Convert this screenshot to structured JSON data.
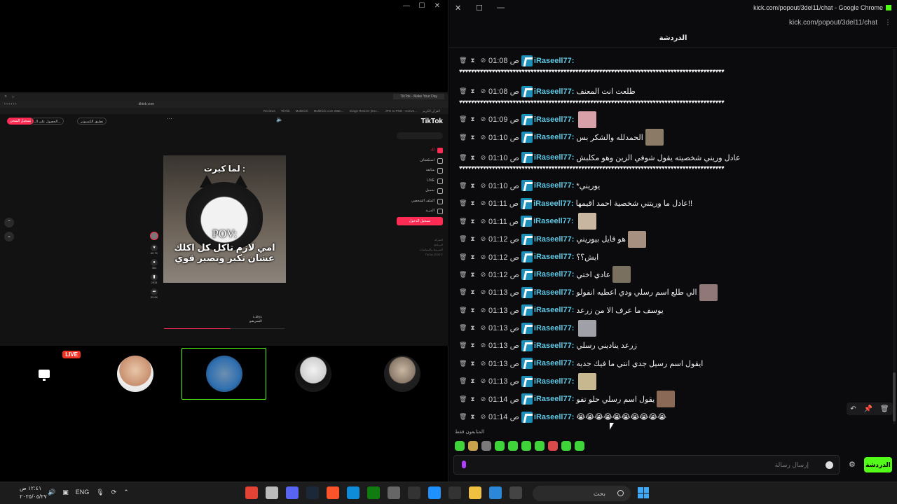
{
  "left_window": {
    "controls": [
      "—",
      "☐",
      "✕"
    ],
    "embedded_browser": {
      "tab_label": "TikTok - Make Your Day",
      "url": "tiktok.com",
      "bookmarks": [
        "Reviews",
        "TikTok",
        "MultiKick",
        "MultiKick.com Watc...",
        "Image Resizer (Exc...",
        "JPG to PNG - Conve...",
        "القرآن الكريم"
      ],
      "tiktok": {
        "logo": "TikTok",
        "live_button": "تسجيل الشحن",
        "get_app": "الحصول على ال...",
        "pc_app": "تطبيق الكمبيوتر",
        "nav": [
          "لك",
          "استكشاف",
          "متابعة",
          "LIVE",
          "تحميل",
          "الملف الشخصي",
          "المزيد"
        ],
        "login": "تسجيل الدخول",
        "footer": [
          "الشركة",
          "البرنامج",
          "الشروط والسياسات",
          "TikTok 2025 ©"
        ],
        "video_caption_top": "لما كبرت :",
        "video_caption_pov": "POV:",
        "video_caption_main": "امي لازم تاكل كل اكلك عشان تكبر وتصير قوي",
        "counts": [
          "60.7K",
          "364",
          "2934",
          "35.6K"
        ],
        "user_handle": "L.dry1",
        "user_sub": "التسريقيو"
      }
    },
    "tiles": {
      "live_badge": "LIVE",
      "colors": [
        "#101010",
        "#c0707a",
        "#2e3a2e",
        "#5a5a5a",
        "#222222"
      ]
    }
  },
  "right_window": {
    "title": "kick.com/popout/3del11/chat - Google Chrome",
    "url": "kick.com/popout/3del11/chat",
    "chat_header": "الدردشة",
    "messages": [
      {
        "time": "01:08",
        "ampm": "ص",
        "user": "iRaseell77:",
        "text": "",
        "line": "♥♥♥♥♥♥♥♥♥♥♥♥♥♥♥♥♥♥♥♥♥♥♥♥♥♥♥♥♥♥♥♥♥♥♥♥♥♥♥♥♥♥♥♥♥♥♥♥♥♥♥♥♥♥♥♥♥♥♥♥♥♥♥♥♥♥♥♥♥♥♥♥♥♥♥♥♥♥♥♥♥♥♥♥♥♥♥♥♥",
        "emotes": []
      },
      {
        "time": "01:08",
        "ampm": "ص",
        "user": "iRaseell77:",
        "text": "طلعت انت المعنف",
        "line": "♥♥♥♥♥♥♥♥♥♥♥♥♥♥♥♥♥♥♥♥♥♥♥♥♥♥♥♥♥♥♥♥♥♥♥♥♥♥♥♥♥♥♥♥♥♥♥♥♥♥♥♥♥♥♥♥♥♥♥♥♥♥♥♥♥♥♥♥♥♥♥♥♥♥♥♥♥♥♥♥♥♥♥♥♥♥♥♥♥",
        "emotes": []
      },
      {
        "time": "01:09",
        "ampm": "ص",
        "user": "iRaseell77:",
        "text": "",
        "line": "",
        "emotes": [
          "#d8a0a8"
        ]
      },
      {
        "time": "01:10",
        "ampm": "ص",
        "user": "iRaseell77:",
        "text": "الحمدلله والشكر بس",
        "line": "",
        "emotes": [
          "#8a7a66"
        ]
      },
      {
        "time": "01:10",
        "ampm": "ص",
        "user": "iRaseell77:",
        "text": "عادل وريني شخصيته يقول شوفي الزين وهو مكلبش",
        "line": "♥♥♥♥♥♥♥♥♥♥♥♥♥♥♥♥♥♥♥♥♥♥♥♥♥♥♥♥♥♥♥♥♥♥♥♥♥♥♥♥♥♥♥♥♥♥♥♥♥♥♥♥♥♥♥♥♥♥♥♥♥♥♥♥♥♥♥♥♥♥♥♥♥♥♥♥♥♥♥♥♥♥♥♥♥♥♥♥♥",
        "emotes": []
      },
      {
        "time": "01:10",
        "ampm": "ص",
        "user": "iRaseell77:",
        "text": "*يوريني",
        "line": "",
        "emotes": []
      },
      {
        "time": "01:11",
        "ampm": "ص",
        "user": "iRaseell77:",
        "text": "عادل ما وريتني شخصية احمد اقيمها!!",
        "line": "",
        "emotes": []
      },
      {
        "time": "01:11",
        "ampm": "ص",
        "user": "iRaseell77:",
        "text": "",
        "line": "",
        "emotes": [
          "#c8b6a0"
        ]
      },
      {
        "time": "01:12",
        "ampm": "ص",
        "user": "iRaseell77:",
        "text": "هو قايل بيوريني",
        "line": "",
        "emotes": [
          "#a89080"
        ]
      },
      {
        "time": "01:12",
        "ampm": "ص",
        "user": "iRaseell77:",
        "text": "ايش؟؟",
        "line": "",
        "emotes": []
      },
      {
        "time": "01:12",
        "ampm": "ص",
        "user": "iRaseell77:",
        "text": "عادي اختي",
        "line": "",
        "emotes": [
          "#7a7060"
        ]
      },
      {
        "time": "01:13",
        "ampm": "ص",
        "user": "iRaseell77:",
        "text": "الي طلع اسم رسلي ودي اعطيه انفولو",
        "line": "",
        "emotes": [
          "#907878"
        ]
      },
      {
        "time": "01:13",
        "ampm": "ص",
        "user": "iRaseell77:",
        "text": "يوسف ما عرف الا من زرعد",
        "line": "",
        "emotes": []
      },
      {
        "time": "01:13",
        "ampm": "ص",
        "user": "iRaseell77:",
        "text": "",
        "line": "",
        "emotes": [
          "#a0a0a8"
        ]
      },
      {
        "time": "01:13",
        "ampm": "ص",
        "user": "iRaseell77:",
        "text": "زرعد يناديني رسلي",
        "line": "",
        "emotes": []
      },
      {
        "time": "01:13",
        "ampm": "ص",
        "user": "iRaseell77:",
        "text": "ايقول اسم رسيل جدي انتي ما فيك جديه",
        "line": "",
        "emotes": []
      },
      {
        "time": "01:13",
        "ampm": "ص",
        "user": "iRaseell77:",
        "text": "",
        "line": "",
        "emotes": [
          "#c8b890"
        ]
      },
      {
        "time": "01:14",
        "ampm": "ص",
        "user": "iRaseell77:",
        "text": "يقول اسم رسلي حلو تفو",
        "line": "",
        "emotes": [
          "#8a6a56"
        ]
      },
      {
        "time": "01:14",
        "ampm": "ص",
        "user": "iRaseell77:",
        "text": "😭😭😭😭😭😭😭😭😭😭",
        "line": "",
        "emotes": []
      }
    ],
    "hover_actions": [
      "↶",
      "📌",
      "🗑"
    ],
    "emote_label": "المتابعون فقط",
    "input_placeholder": "إرسال رسالة",
    "chat_button": "الدردشة"
  },
  "taskbar": {
    "time": "١٢:٤١ ص",
    "date": "٢٠٢٥/٠٥/٢٧",
    "lang": "ENG",
    "search_placeholder": "بحث",
    "app_colors": [
      "#e34234",
      "#bbbbbb",
      "#5865f2",
      "#1b2838",
      "#fb542b",
      "#0f8cd9",
      "#107c10",
      "#666666",
      "#333333",
      "#1e90ff",
      "#333333",
      "#f0c040",
      "#2b88d8",
      "#444444"
    ]
  }
}
